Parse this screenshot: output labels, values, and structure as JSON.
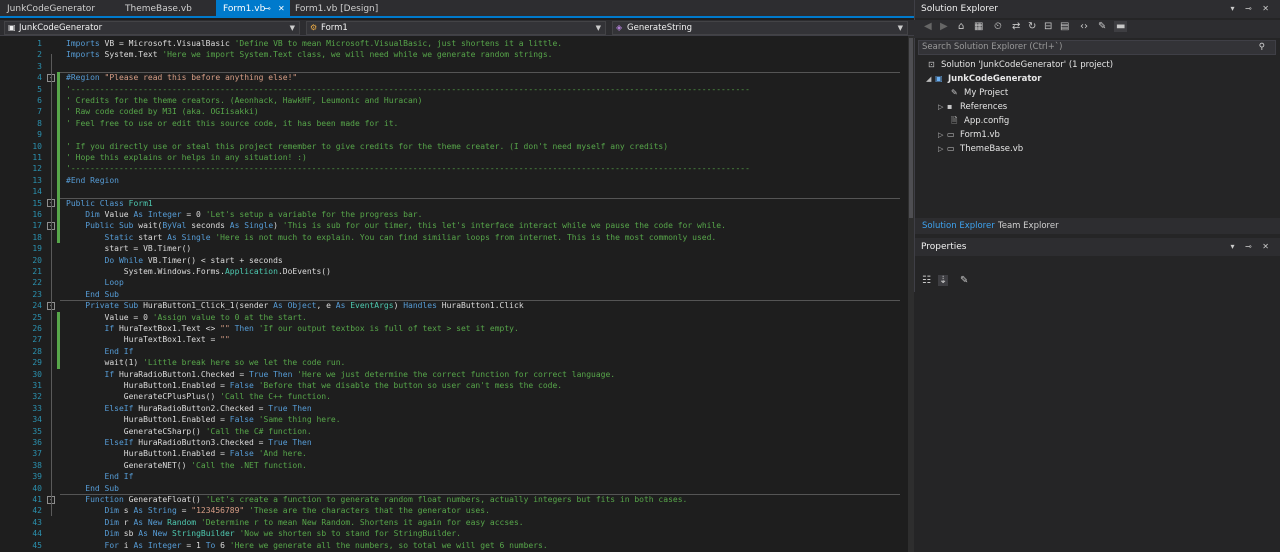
{
  "tabs": [
    {
      "label": "JunkCodeGenerator",
      "active": false
    },
    {
      "label": "ThemeBase.vb",
      "active": false
    },
    {
      "label": "Form1.vb",
      "active": true
    },
    {
      "label": "Form1.vb [Design]",
      "active": false
    }
  ],
  "navbar": {
    "project": "JunkCodeGenerator",
    "class": "Form1",
    "member": "GenerateString"
  },
  "code_lines": [
    {
      "n": "1",
      "html": "<span class=\"k\">Imports</span> VB = Microsoft.VisualBasic <span class=\"c\">'Define VB to mean Microsoft.VisualBasic, just shortens it a little.</span>"
    },
    {
      "n": "2",
      "html": "<span class=\"k\">Imports</span> System.Text <span class=\"c\">'Here we import System.Text class, we will need while we generate random strings.</span>"
    },
    {
      "n": "3",
      "html": ""
    },
    {
      "n": "4",
      "html": "<span class=\"k\">#Region</span> <span class=\"s\">\"Please read this before anything else!\"</span>"
    },
    {
      "n": "5",
      "html": "<span class=\"c\">'---------------------------------------------------------------------------------------------------------------------------------------------</span>"
    },
    {
      "n": "6",
      "html": "<span class=\"c\">' Credits for the theme creators. (Aeonhack, HawkHF, Leumonic and Huracan)</span>"
    },
    {
      "n": "7",
      "html": "<span class=\"c\">' Raw code coded by M3I (aka. OGIisakki)</span>"
    },
    {
      "n": "8",
      "html": "<span class=\"c\">' Feel free to use or edit this source code, it has been made for it.</span>"
    },
    {
      "n": "9",
      "html": ""
    },
    {
      "n": "10",
      "html": "<span class=\"c\">' If you directly use or steal this project remember to give credits for the theme creater. (I don't need myself any credits)</span>"
    },
    {
      "n": "11",
      "html": "<span class=\"c\">' Hope this explains or helps in any situation! :)</span>"
    },
    {
      "n": "12",
      "html": "<span class=\"c\">'---------------------------------------------------------------------------------------------------------------------------------------------</span>"
    },
    {
      "n": "13",
      "html": "<span class=\"k\">#End Region</span>"
    },
    {
      "n": "14",
      "html": ""
    },
    {
      "n": "15",
      "html": "<span class=\"k\">Public Class</span> <span class=\"t\">Form1</span>"
    },
    {
      "n": "16",
      "html": "    <span class=\"k\">Dim</span> Value <span class=\"k\">As Integer</span> = 0 <span class=\"c\">'Let's setup a variable for the progress bar.</span>"
    },
    {
      "n": "17",
      "html": "    <span class=\"k\">Public Sub</span> wait(<span class=\"k\">ByVal</span> seconds <span class=\"k\">As Single</span>) <span class=\"c\">'This is sub for our timer, this let's interface interact while we pause the code for while.</span>"
    },
    {
      "n": "18",
      "html": "        <span class=\"k\">Static</span> start <span class=\"k\">As Single</span> <span class=\"c\">'Here is not much to explain. You can find similiar loops from internet. This is the most commonly used.</span>"
    },
    {
      "n": "19",
      "html": "        start = VB.Timer()"
    },
    {
      "n": "20",
      "html": "        <span class=\"k\">Do While</span> VB.Timer() &lt; start + seconds"
    },
    {
      "n": "21",
      "html": "            System.Windows.Forms.<span class=\"t\">Application</span>.DoEvents()"
    },
    {
      "n": "22",
      "html": "        <span class=\"k\">Loop</span>"
    },
    {
      "n": "23",
      "html": "    <span class=\"k\">End Sub</span>"
    },
    {
      "n": "24",
      "html": "    <span class=\"k\">Private Sub</span> HuraButton1_Click_1(sender <span class=\"k\">As</span> <span class=\"k\">Object</span>, e <span class=\"k\">As</span> <span class=\"t\">EventArgs</span>) <span class=\"k\">Handles</span> HuraButton1.Click"
    },
    {
      "n": "25",
      "html": "        Value = 0 <span class=\"c\">'Assign value to 0 at the start.</span>"
    },
    {
      "n": "26",
      "html": "        <span class=\"k\">If</span> HuraTextBox1.Text &lt;&gt; <span class=\"s\">\"\"</span> <span class=\"k\">Then</span> <span class=\"c\">'If our output textbox is full of text &gt; set it empty.</span>"
    },
    {
      "n": "27",
      "html": "            HuraTextBox1.Text = <span class=\"s\">\"\"</span>"
    },
    {
      "n": "28",
      "html": "        <span class=\"k\">End If</span>"
    },
    {
      "n": "29",
      "html": "        wait(1) <span class=\"c\">'Little break here so we let the code run.</span>"
    },
    {
      "n": "30",
      "html": "        <span class=\"k\">If</span> HuraRadioButton1.Checked = <span class=\"k\">True Then</span> <span class=\"c\">'Here we just determine the correct function for correct language.</span>"
    },
    {
      "n": "31",
      "html": "            HuraButton1.Enabled = <span class=\"k\">False</span> <span class=\"c\">'Before that we disable the button so user can't mess the code.</span>"
    },
    {
      "n": "32",
      "html": "            GenerateCPlusPlus() <span class=\"c\">'Call the C++ function.</span>"
    },
    {
      "n": "33",
      "html": "        <span class=\"k\">ElseIf</span> HuraRadioButton2.Checked = <span class=\"k\">True Then</span>"
    },
    {
      "n": "34",
      "html": "            HuraButton1.Enabled = <span class=\"k\">False</span> <span class=\"c\">'Same thing here.</span>"
    },
    {
      "n": "35",
      "html": "            GenerateCSharp() <span class=\"c\">'Call the C# function.</span>"
    },
    {
      "n": "36",
      "html": "        <span class=\"k\">ElseIf</span> HuraRadioButton3.Checked = <span class=\"k\">True Then</span>"
    },
    {
      "n": "37",
      "html": "            HuraButton1.Enabled = <span class=\"k\">False</span> <span class=\"c\">'And here.</span>"
    },
    {
      "n": "38",
      "html": "            GenerateNET() <span class=\"c\">'Call the .NET function.</span>"
    },
    {
      "n": "39",
      "html": "        <span class=\"k\">End If</span>"
    },
    {
      "n": "40",
      "html": "    <span class=\"k\">End Sub</span>"
    },
    {
      "n": "41",
      "html": "    <span class=\"k\">Function</span> GenerateFloat() <span class=\"c\">'Let's create a function to generate random float numbers, actually integers but fits in both cases.</span>"
    },
    {
      "n": "42",
      "html": "        <span class=\"k\">Dim</span> s <span class=\"k\">As String</span> = <span class=\"s\">\"123456789\"</span> <span class=\"c\">'These are the characters that the generator uses.</span>"
    },
    {
      "n": "43",
      "html": "        <span class=\"k\">Dim</span> r <span class=\"k\">As New</span> <span class=\"t\">Random</span> <span class=\"c\">'Determine r to mean New Random. Shortens it again for easy accses.</span>"
    },
    {
      "n": "44",
      "html": "        <span class=\"k\">Dim</span> sb <span class=\"k\">As New</span> <span class=\"t\">StringBuilder</span> <span class=\"c\">'Now we shorten sb to stand for StringBuilder.</span>"
    },
    {
      "n": "45",
      "html": "        <span class=\"k\">For</span> i <span class=\"k\">As Integer</span> = 1 <span class=\"k\">To</span> 6 <span class=\"c\">'Here we generate all the numbers, so total we will get 6 numbers.</span>"
    }
  ],
  "solution_explorer": {
    "title": "Solution Explorer",
    "search_placeholder": "Search Solution Explorer (Ctrl+`)",
    "items": [
      {
        "label": "Solution 'JunkCodeGenerator' (1 project)",
        "icon": "solution-icon"
      },
      {
        "label": "JunkCodeGenerator",
        "icon": "vb-project-icon"
      },
      {
        "label": "My Project",
        "icon": "wrench-icon"
      },
      {
        "label": "References",
        "icon": "references-icon"
      },
      {
        "label": "App.config",
        "icon": "config-file-icon"
      },
      {
        "label": "Form1.vb",
        "icon": "form-file-icon"
      },
      {
        "label": "ThemeBase.vb",
        "icon": "vb-file-icon"
      }
    ],
    "bottom_tabs": [
      "Solution Explorer",
      "Team Explorer"
    ]
  },
  "properties": {
    "title": "Properties"
  },
  "colors": {
    "accent": "#007acc",
    "keyword": "#569cd6",
    "comment": "#57a64a",
    "string": "#d69d85",
    "type": "#4ec9b0",
    "line_number": "#2b91af"
  }
}
